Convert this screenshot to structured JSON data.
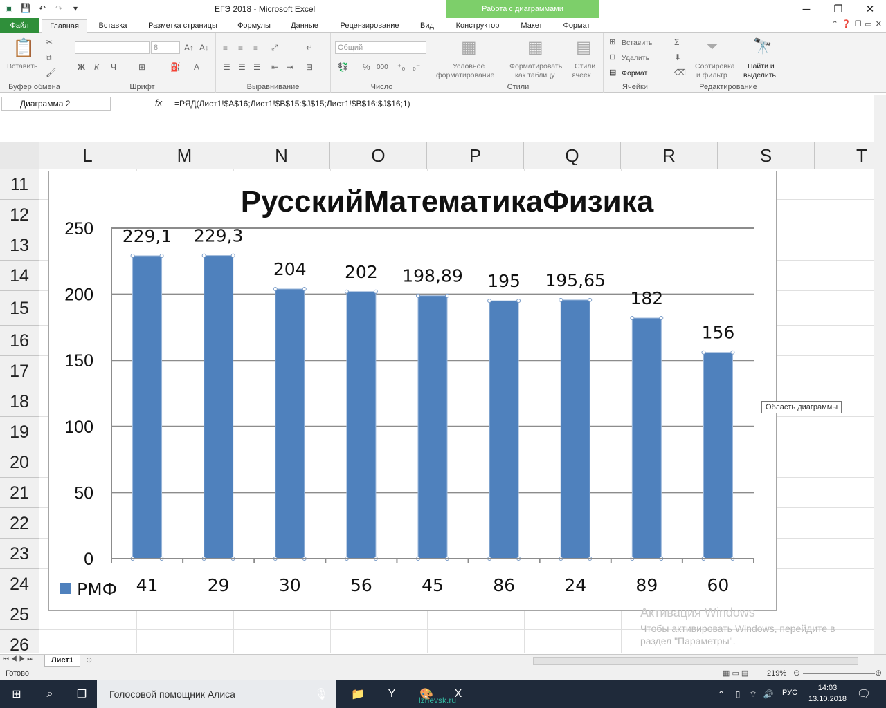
{
  "window": {
    "title": "ЕГЭ 2018  -  Microsoft Excel",
    "context_band": "Работа с диаграммами"
  },
  "tabs": [
    "Файл",
    "Главная",
    "Вставка",
    "Разметка страницы",
    "Формулы",
    "Данные",
    "Рецензирование",
    "Вид",
    "Конструктор",
    "Макет",
    "Формат"
  ],
  "ribbon": {
    "clipboard": {
      "paste": "Вставить",
      "label": "Буфер обмена"
    },
    "font": {
      "label": "Шрифт",
      "size": "8",
      "bold": "Ж",
      "italic": "К",
      "underline": "Ч"
    },
    "alignment": {
      "label": "Выравнивание"
    },
    "number": {
      "label": "Число",
      "format": "Общий",
      "percent": "%",
      "thousands": "000"
    },
    "styles": {
      "label": "Стили",
      "cond_1": "Условное",
      "cond_2": "форматирование",
      "table_1": "Форматировать",
      "table_2": "как таблицу",
      "cell_1": "Стили",
      "cell_2": "ячеек"
    },
    "cells": {
      "label": "Ячейки",
      "insert": "Вставить",
      "delete": "Удалить",
      "format": "Формат"
    },
    "editing": {
      "label": "Редактирование",
      "sort_1": "Сортировка",
      "sort_2": "и фильтр",
      "find_1": "Найти и",
      "find_2": "выделить"
    }
  },
  "formula_bar": {
    "name_box": "Диаграмма 2",
    "fx": "fx",
    "formula": "=РЯД(Лист1!$A$16;Лист1!$B$15:$J$15;Лист1!$B$16:$J$16;1)"
  },
  "grid": {
    "columns": [
      "L",
      "M",
      "N",
      "O",
      "P",
      "Q",
      "R",
      "S",
      "T"
    ],
    "rows": [
      "11",
      "12",
      "13",
      "14",
      "15",
      "16",
      "17",
      "18",
      "19",
      "20",
      "21",
      "22",
      "23",
      "24",
      "25",
      "26"
    ]
  },
  "chart_data": {
    "type": "bar",
    "title": "РусскийМатематикаФизика",
    "categories": [
      "41",
      "29",
      "30",
      "56",
      "45",
      "86",
      "24",
      "89",
      "60"
    ],
    "series": [
      {
        "name": "РМФ",
        "values": [
          229.1,
          229.3,
          204,
          202,
          198.89,
          195,
          195.65,
          182,
          156
        ]
      }
    ],
    "data_labels": [
      "229,1",
      "229,3",
      "204",
      "202",
      "198,89",
      "195",
      "195,65",
      "182",
      "156"
    ],
    "y_ticks": [
      "0",
      "50",
      "100",
      "150",
      "200",
      "250"
    ],
    "ylim": [
      0,
      250
    ],
    "grid": true,
    "legend": "bottom-left",
    "bar_color": "#4f81bd"
  },
  "tooltip": "Область диаграммы",
  "watermark": {
    "line1": "Активация Windows",
    "line2": "Чтобы активировать Windows, перейдите в раздел \"Параметры\"."
  },
  "sheet_tab": "Лист1",
  "status": {
    "ready": "Готово",
    "zoom": "219%"
  },
  "taskbar": {
    "search": "Голосовой помощник Алиса",
    "lang": "РУС",
    "time": "14:03",
    "date": "13.10.2018",
    "site": "lzhevsk.ru"
  }
}
